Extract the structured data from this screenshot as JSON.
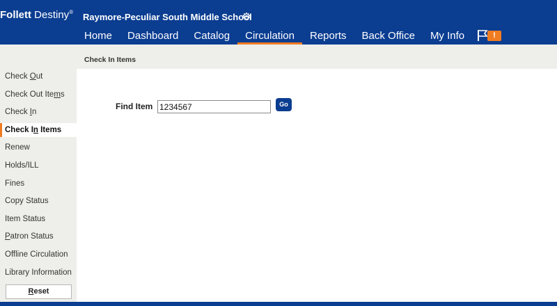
{
  "header": {
    "brand_bold": "Follett",
    "brand_light": " Destiny",
    "brand_reg": "®",
    "school_name": "Raymore-Peculiar South Middle School",
    "alert_badge": "!",
    "nav": [
      {
        "label": "Home",
        "active": false
      },
      {
        "label": "Dashboard",
        "active": false
      },
      {
        "label": "Catalog",
        "active": false
      },
      {
        "label": "Circulation",
        "active": true
      },
      {
        "label": "Reports",
        "active": false
      },
      {
        "label": "Back Office",
        "active": false
      },
      {
        "label": "My Info",
        "active": false
      }
    ]
  },
  "breadcrumb": "Check In Items",
  "sidebar": {
    "items": [
      {
        "pre": "Check ",
        "key": "O",
        "post": "ut"
      },
      {
        "pre": "Check Out Ite",
        "key": "m",
        "post": "s"
      },
      {
        "pre": "Check ",
        "key": "I",
        "post": "n"
      },
      {
        "pre": "Check I",
        "key": "n",
        "post": " Items",
        "active": true
      },
      {
        "pre": "Renew",
        "key": "",
        "post": ""
      },
      {
        "pre": "Holds/ILL",
        "key": "",
        "post": ""
      },
      {
        "pre": "Fines",
        "key": "",
        "post": ""
      },
      {
        "pre": "Copy Status",
        "key": "",
        "post": ""
      },
      {
        "pre": "Item Status",
        "key": "",
        "post": ""
      },
      {
        "pre": "",
        "key": "P",
        "post": "atron Status"
      },
      {
        "pre": "Offline Circulation",
        "key": "",
        "post": ""
      },
      {
        "pre": "Library Information",
        "key": "",
        "post": ""
      }
    ],
    "reset_key": "R",
    "reset_rest": "eset"
  },
  "form": {
    "find_label": "Find Item",
    "find_value": "1234567",
    "go_label": "Go"
  },
  "colors": {
    "header_bg": "#0b3d91",
    "accent": "#f07c22",
    "sidebar_bg": "#eeeeea"
  }
}
